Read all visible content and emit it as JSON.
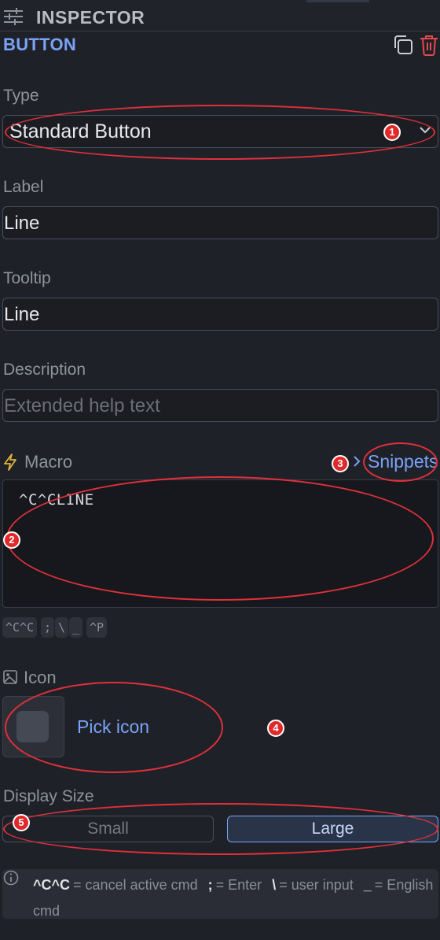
{
  "header": {
    "title": "INSPECTOR",
    "icon": "sliders-icon"
  },
  "section": {
    "title": "BUTTON",
    "actions": [
      "copy-icon",
      "trash-icon"
    ],
    "trash_color": "#e5484d"
  },
  "fields": {
    "type": {
      "label": "Type",
      "value": "Standard Button"
    },
    "label": {
      "label": "Label",
      "value": "Line"
    },
    "tooltip": {
      "label": "Tooltip",
      "value": "Line"
    },
    "description": {
      "label": "Description",
      "placeholder": "Extended help text"
    }
  },
  "macro": {
    "label": "Macro",
    "snippets_label": "Snippets",
    "value": "^C^CLINE",
    "chips": [
      "^C^C",
      ";",
      "\\",
      "_",
      "^P"
    ]
  },
  "icon_picker": {
    "label": "Icon",
    "pick_label": "Pick icon"
  },
  "display_size": {
    "label": "Display Size",
    "options": [
      "Small",
      "Large"
    ],
    "selected": "Large"
  },
  "info": {
    "items": [
      {
        "key": "^C^C",
        "desc": "= cancel active cmd"
      },
      {
        "key": ";",
        "desc": "= Enter"
      },
      {
        "key": "\\",
        "desc": "= user input"
      },
      {
        "key": "_",
        "desc": "= English cmd"
      }
    ]
  },
  "annotations": [
    "1",
    "2",
    "3",
    "4",
    "5"
  ],
  "colors": {
    "accent": "#7aa2f7",
    "background": "#1f2128",
    "annotation": "#e0303a"
  }
}
